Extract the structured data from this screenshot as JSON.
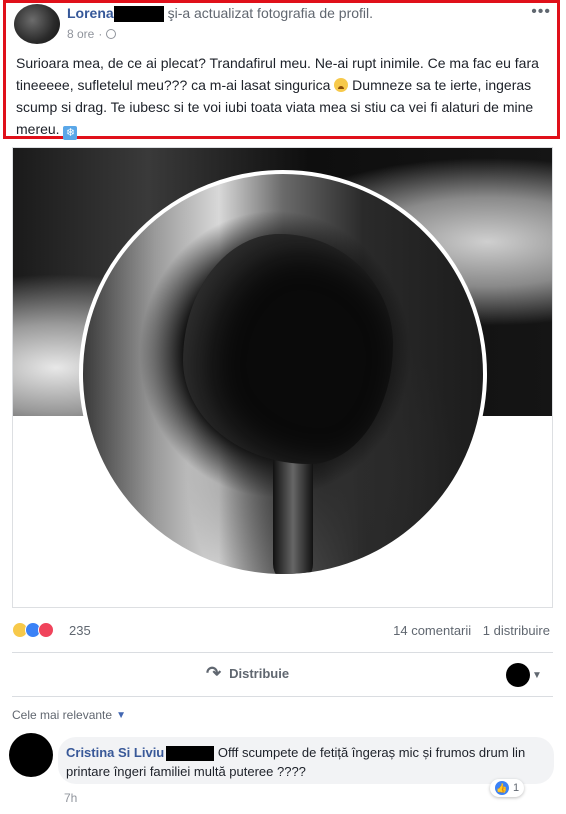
{
  "post": {
    "author": "Lorena",
    "action": " şi-a actualizat fotografia de profil.",
    "time": "8 ore",
    "separator": "·",
    "more_icon": "more-dots-icon",
    "text_part1": "Surioara mea, de ce ai plecat? Trandafirul meu. Ne-ai rupt inimile. Ce ma fac eu fara tineeeee, sufletelul meu??? ca m-ai lasat singurica ",
    "text_part2": " Dumneze sa te ierte, ingeras scump si drag. Te iubesc si te voi iubi toata viata mea si stiu ca vei fi alaturi de mine mereu. ",
    "emoji_cry": "crying-face-emoji",
    "emoji_snow": "❄"
  },
  "stats": {
    "reactions": [
      "sad",
      "like",
      "love"
    ],
    "reaction_count": "235",
    "comments": "14 comentarii",
    "shares": "1 distribuire"
  },
  "actions": {
    "share_label": "Distribuie",
    "share_icon": "↷"
  },
  "comments_section": {
    "sort_label": "Cele mai relevante",
    "sort_caret": "▼",
    "comment": {
      "author": "Cristina Si Liviu",
      "text": " Offf scumpete de fetiță îngeraș mic și frumos drum lin printare îngeri familiei multă puteree ????",
      "time": "7h",
      "likes": "1",
      "like_icon": "👍"
    }
  },
  "colors": {
    "highlight_border": "#e0101a",
    "link_blue": "#365899",
    "like_blue": "#3b82f6",
    "love_red": "#f0435b"
  }
}
